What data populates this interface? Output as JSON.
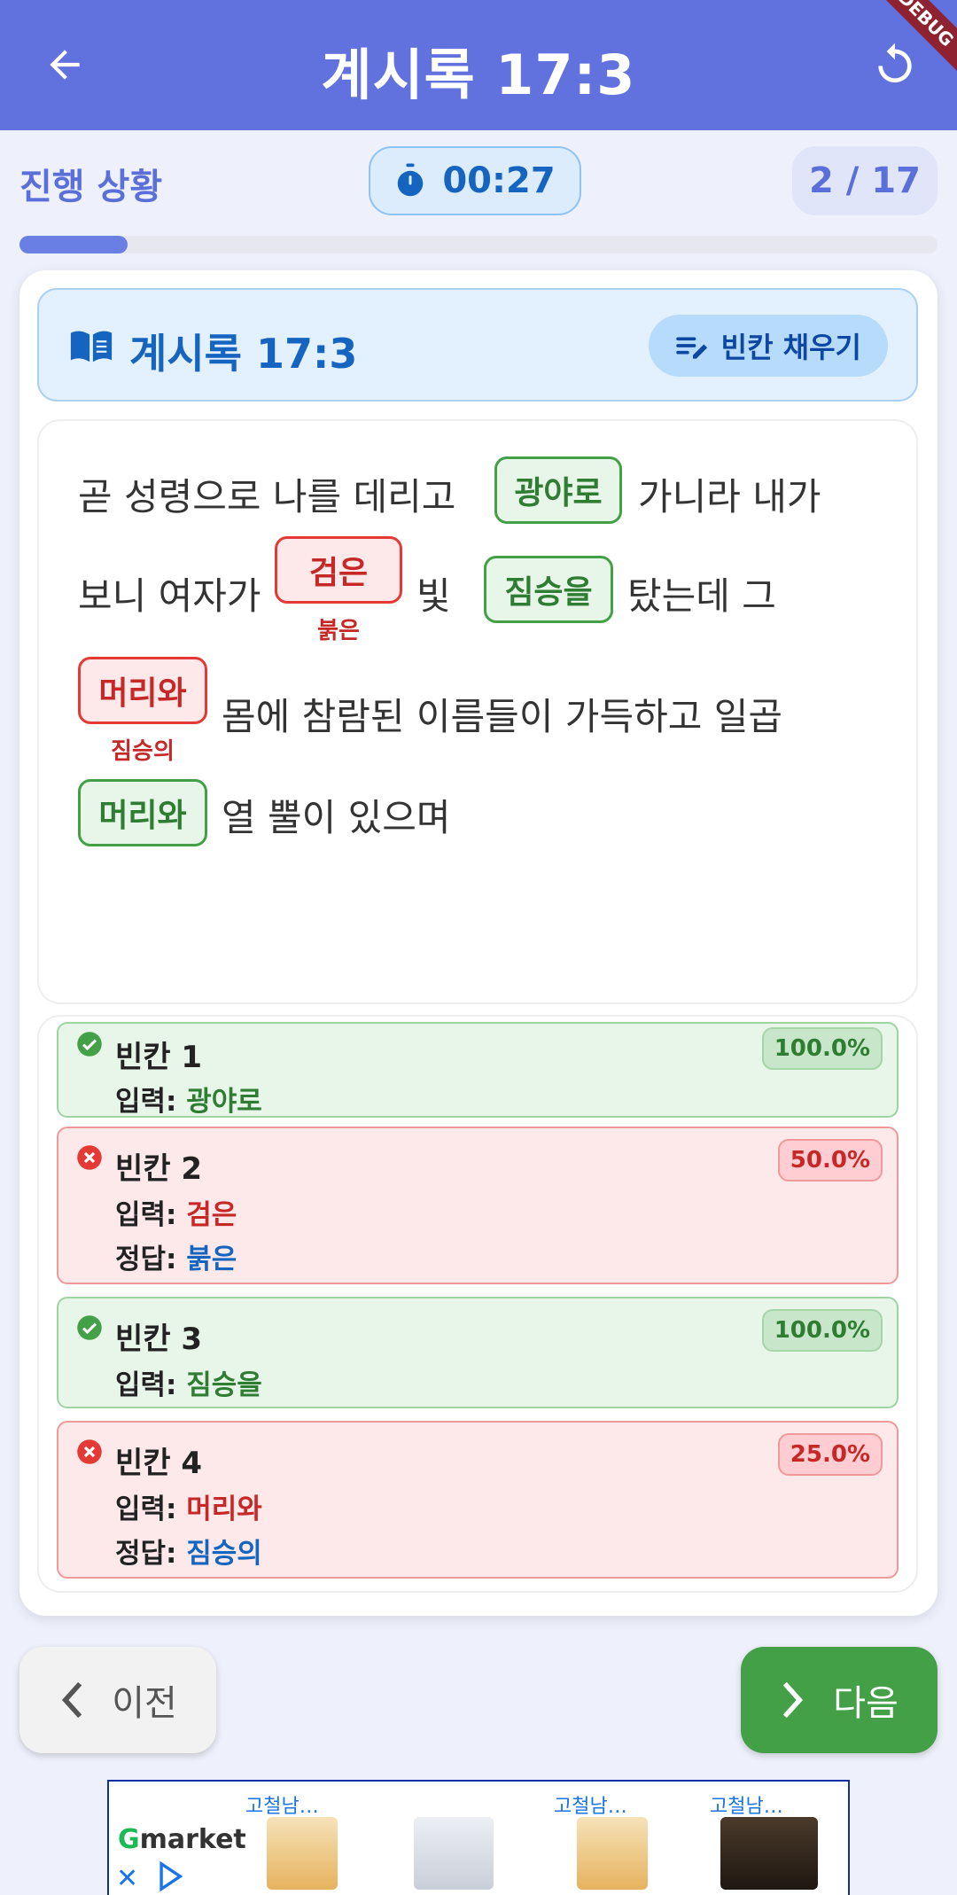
{
  "appbar": {
    "title": "계시록 17:3",
    "debug_label": "DEBUG"
  },
  "progress": {
    "label": "진행 상황",
    "timer": "00:27",
    "counter": "2 / 17",
    "fraction": 0.118
  },
  "verse": {
    "reference": "계시록 17:3",
    "mode": "빈칸 채우기"
  },
  "passage": {
    "line1": {
      "before": "곧 성령으로 나를 데리고",
      "blank": "광야로",
      "after": "가니라 내가"
    },
    "line2": {
      "before": "보니 여자가",
      "blank_a": "검은",
      "correction_a": "붉은",
      "middle": "빛",
      "blank_b": "짐승을",
      "after": "탔는데 그"
    },
    "line3": {
      "blank": "머리와",
      "correction": "짐승의",
      "after": "몸에 참람된 이름들이 가득하고 일곱"
    },
    "line4": {
      "blank": "머리와",
      "after": "열 뿔이 있으며"
    }
  },
  "results": [
    {
      "title": "빈칸 1",
      "input_label": "입력:",
      "input": "광야로",
      "score": "100.0%",
      "status": "correct"
    },
    {
      "title": "빈칸 2",
      "input_label": "입력:",
      "input": "검은",
      "answer_label": "정답:",
      "answer": "붉은",
      "score": "50.0%",
      "status": "wrong"
    },
    {
      "title": "빈칸 3",
      "input_label": "입력:",
      "input": "짐승을",
      "score": "100.0%",
      "status": "correct"
    },
    {
      "title": "빈칸 4",
      "input_label": "입력:",
      "input": "머리와",
      "answer_label": "정답:",
      "answer": "짐승의",
      "score": "25.0%",
      "status": "wrong"
    }
  ],
  "nav": {
    "prev_label": "이전",
    "next_label": "다음"
  },
  "ad": {
    "brand_g": "G",
    "brand_rest": "market",
    "item_label_1": "고철남…",
    "item_label_2": "고철남…",
    "item_label_3": "고철남…"
  },
  "colors": {
    "primary": "#6172df",
    "correct": "#43a047",
    "wrong": "#e53935",
    "accent_blue": "#1565c0"
  },
  "icons": {
    "back": "arrow-left-icon",
    "reset": "refresh-icon",
    "timer": "stopwatch-icon",
    "book": "book-icon",
    "mode": "edit-note-icon"
  }
}
